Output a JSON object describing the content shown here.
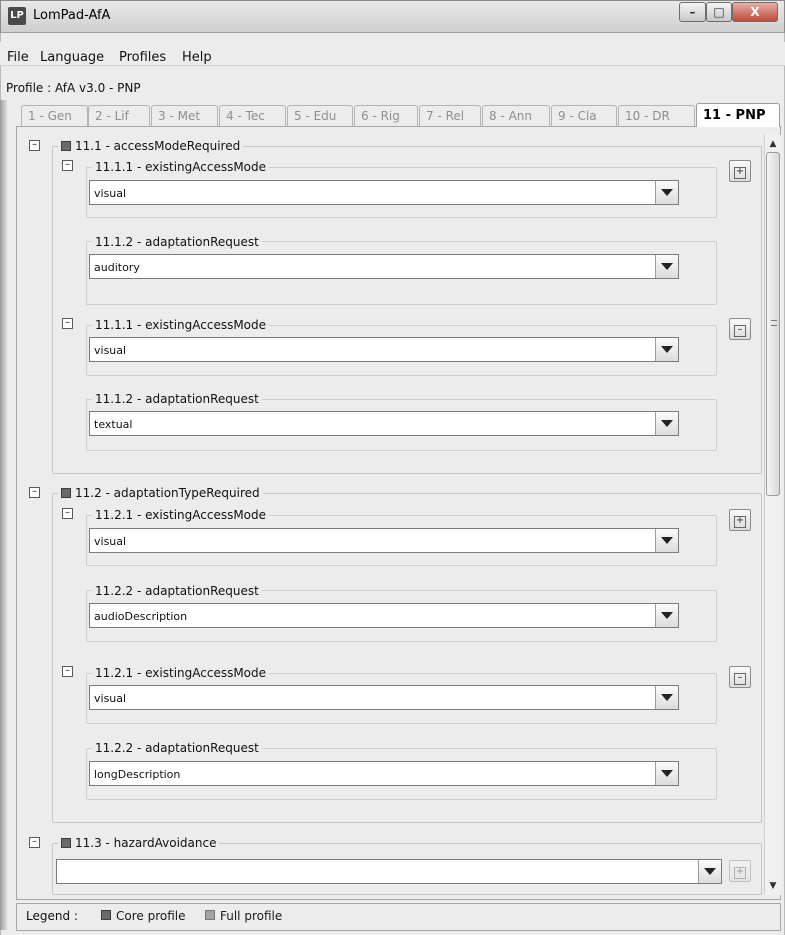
{
  "window": {
    "title": "LomPad-AfA",
    "logo_text": "LP",
    "buttons": {
      "minimize": "–",
      "maximize": "□",
      "close": "X"
    }
  },
  "menu": [
    "File",
    "Language",
    "Profiles",
    "Help"
  ],
  "profile_line": "Profile : AfA v3.0 - PNP",
  "tabs": [
    {
      "label": "1 - Gen",
      "active": false
    },
    {
      "label": "2 - Lif",
      "active": false
    },
    {
      "label": "3 - Met",
      "active": false
    },
    {
      "label": "4 - Tec",
      "active": false
    },
    {
      "label": "5 - Edu",
      "active": false
    },
    {
      "label": "6 - Rig",
      "active": false
    },
    {
      "label": "7 - Rel",
      "active": false
    },
    {
      "label": "8 - Ann",
      "active": false
    },
    {
      "label": "9 - Cla",
      "active": false
    },
    {
      "label": "10 - DR",
      "active": false
    },
    {
      "label": "11 - PNP",
      "active": true
    }
  ],
  "sections": {
    "s1": {
      "title": "11.1 - accessModeRequired",
      "entries": [
        {
          "existing_label": "11.1.1 - existingAccessMode",
          "existing_value": "visual",
          "request_label": "11.1.2 - adaptationRequest",
          "request_value": "auditory",
          "side_button": "+"
        },
        {
          "existing_label": "11.1.1 - existingAccessMode",
          "existing_value": "visual",
          "request_label": "11.1.2 - adaptationRequest",
          "request_value": "textual",
          "side_button": "–"
        }
      ]
    },
    "s2": {
      "title": "11.2 - adaptationTypeRequired",
      "entries": [
        {
          "existing_label": "11.2.1 - existingAccessMode",
          "existing_value": "visual",
          "request_label": "11.2.2 - adaptationRequest",
          "request_value": "audioDescription",
          "side_button": "+"
        },
        {
          "existing_label": "11.2.1 - existingAccessMode",
          "existing_value": "visual",
          "request_label": "11.2.2 - adaptationRequest",
          "request_value": "longDescription",
          "side_button": "–"
        }
      ]
    },
    "s3": {
      "title": "11.3 - hazardAvoidance",
      "value": "",
      "side_button": "+"
    }
  },
  "toggles": {
    "collapse": "–"
  },
  "legend": {
    "label": "Legend :",
    "core": "Core profile",
    "full": "Full profile"
  },
  "colors": {
    "core_profile": "#6a6a6a",
    "full_profile": "#a4a4a4",
    "background": "#ececec"
  }
}
